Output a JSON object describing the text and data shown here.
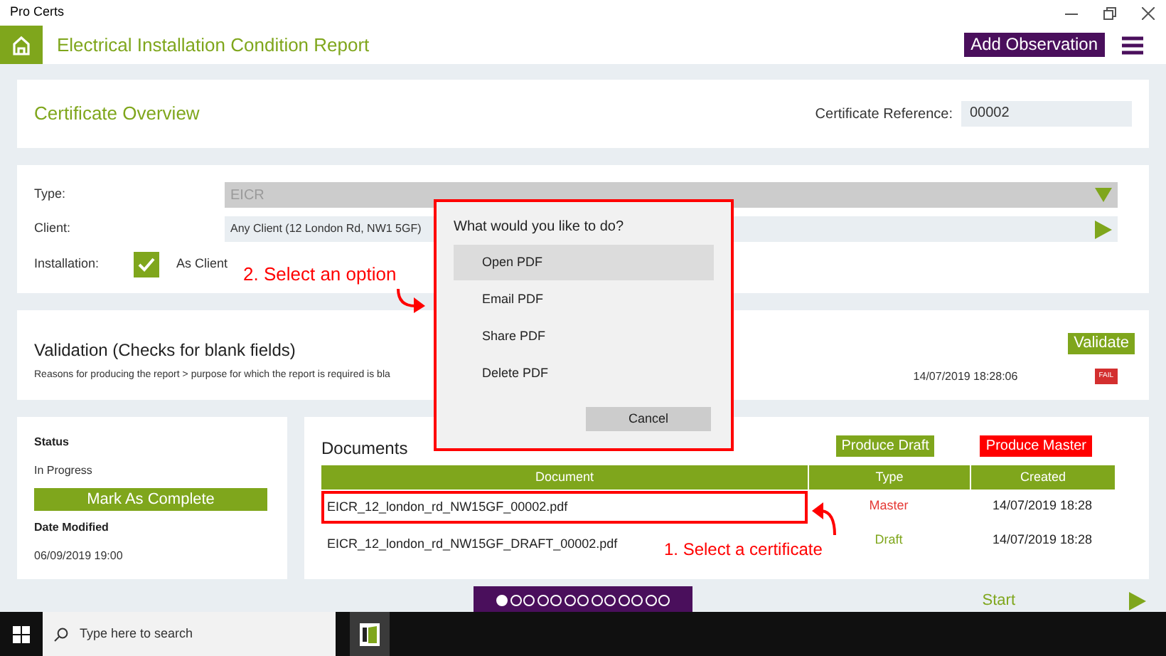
{
  "window": {
    "title": "Pro Certs"
  },
  "header": {
    "title": "Electrical Installation Condition Report",
    "add_button": "Add Observation"
  },
  "overview": {
    "title": "Certificate Overview",
    "reference_label": "Certificate Reference:",
    "reference_value": "00002"
  },
  "details": {
    "type_label": "Type:",
    "type_value": "EICR",
    "client_label": "Client:",
    "client_value": "Any Client (12 London Rd, NW1 5GF)",
    "installation_label": "Installation:",
    "installation_checked": true,
    "installation_text": "As Client"
  },
  "validation": {
    "title": "Validation (Checks for blank fields)",
    "message": "Reasons for producing the report > purpose for which the report is required is bla",
    "timestamp": "14/07/2019 18:28:06",
    "result": "FAIL",
    "button": "Validate"
  },
  "status_panel": {
    "status_label": "Status",
    "status_value": "In Progress",
    "complete_button": "Mark As Complete",
    "modified_label": "Date Modified",
    "modified_value": "06/09/2019 19:00"
  },
  "documents": {
    "title": "Documents",
    "draft_button": "Produce Draft",
    "master_button": "Produce Master",
    "columns": [
      "Document",
      "Type",
      "Created"
    ],
    "rows": [
      {
        "document": "EICR_12_london_rd_NW15GF_00002.pdf",
        "type": "Master",
        "kind": "master",
        "created": "14/07/2019 18:28",
        "outlined": true
      },
      {
        "document": "EICR_12_london_rd_NW15GF_DRAFT_00002.pdf",
        "type": "Draft",
        "kind": "draft",
        "created": "14/07/2019 18:28",
        "outlined": false
      }
    ]
  },
  "dialog": {
    "title": "What would you like to do?",
    "options": [
      {
        "label": "Open PDF",
        "selected": true
      },
      {
        "label": "Email PDF",
        "selected": false
      },
      {
        "label": "Share PDF",
        "selected": false
      },
      {
        "label": "Delete PDF",
        "selected": false
      }
    ],
    "cancel": "Cancel"
  },
  "annotations": [
    "2. Select an option",
    "1. Select a certificate"
  ],
  "pager": [
    {
      "selected": true
    },
    {
      "selected": false
    },
    {
      "selected": false
    },
    {
      "selected": false
    },
    {
      "selected": false
    },
    {
      "selected": false
    },
    {
      "selected": false
    },
    {
      "selected": false
    },
    {
      "selected": false
    },
    {
      "selected": false
    },
    {
      "selected": false
    },
    {
      "selected": false
    },
    {
      "selected": false
    }
  ],
  "footer": {
    "start": "Start"
  },
  "taskbar": {
    "search_placeholder": "Type here to search"
  }
}
